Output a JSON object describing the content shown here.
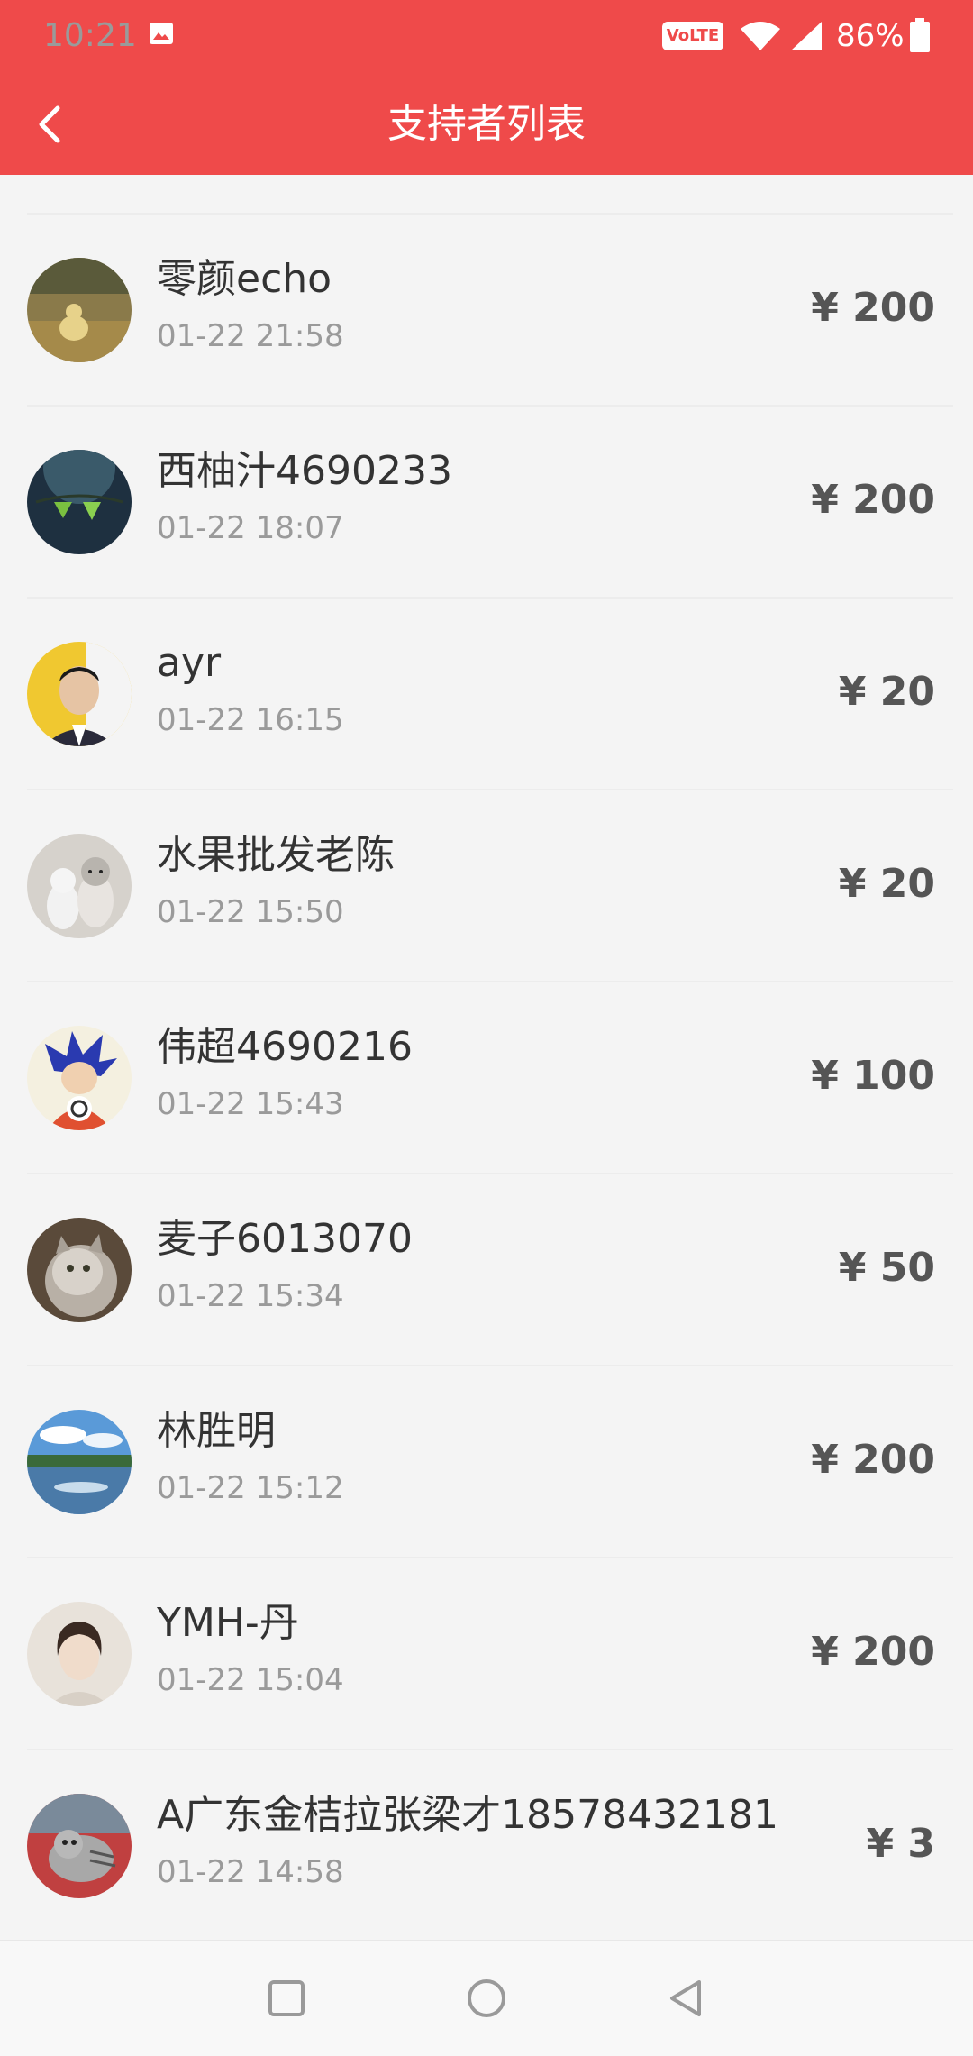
{
  "status_bar": {
    "time": "10:21",
    "volte": "VoLTE",
    "battery_percent": "86%"
  },
  "header": {
    "title": "支持者列表",
    "back_icon": "chevron-left-icon",
    "color": "#ef4a4a"
  },
  "supporters": [
    {
      "name": "零颜echo",
      "time": "01-22 21:58",
      "amount": "¥ 200"
    },
    {
      "name": "西柚汁4690233",
      "time": "01-22 18:07",
      "amount": "¥ 200"
    },
    {
      "name": "ayr",
      "time": "01-22 16:15",
      "amount": "¥ 20"
    },
    {
      "name": "水果批发老陈",
      "time": "01-22 15:50",
      "amount": "¥ 20"
    },
    {
      "name": "伟超4690216",
      "time": "01-22 15:43",
      "amount": "¥ 100"
    },
    {
      "name": "麦子6013070",
      "time": "01-22 15:34",
      "amount": "¥ 50"
    },
    {
      "name": "林胜明",
      "time": "01-22 15:12",
      "amount": "¥ 200"
    },
    {
      "name": "YMH-丹",
      "time": "01-22 15:04",
      "amount": "¥ 200"
    },
    {
      "name": "A广东金桔拉张梁才18578432181",
      "time": "01-22 14:58",
      "amount": "¥ 3"
    }
  ],
  "system_nav": {
    "recents_icon": "square-icon",
    "home_icon": "circle-icon",
    "back_icon": "triangle-back-icon"
  }
}
